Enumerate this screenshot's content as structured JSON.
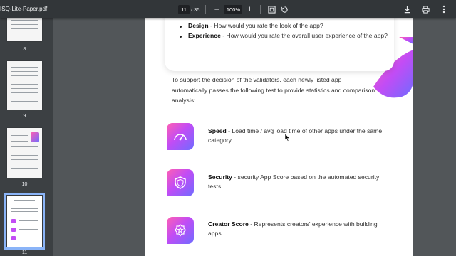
{
  "toolbar": {
    "filename": "ISQ-Lite-Paper.pdf",
    "current_page": "11",
    "separator": "/",
    "total_pages": "35",
    "zoom_out": "–",
    "zoom": "100%",
    "zoom_in": "+"
  },
  "sidebar": {
    "pages": [
      {
        "number": "8"
      },
      {
        "number": "9"
      },
      {
        "number": "10"
      },
      {
        "number": "11"
      }
    ]
  },
  "document": {
    "bullets": [
      {
        "term": "Design",
        "text": " - How would you rate the look of the app?"
      },
      {
        "term": "Experience",
        "text": " - How would you rate the overall user experience of the app?"
      }
    ],
    "intro": "To support the decision of the validators, each newly listed app automatically passes the following test to provide statistics and comparison analysis:",
    "features": [
      {
        "term": "Speed",
        "text": " - Load time / avg load time of other apps under the same category",
        "icon": "speedometer-icon"
      },
      {
        "term": "Security",
        "text": " - security App Score based on the automated security tests",
        "icon": "shield-icon"
      },
      {
        "term": "Creator Score",
        "text": " - Represents creators' experience with building apps",
        "icon": "star-badge-icon"
      }
    ]
  },
  "colors": {
    "gradient_start": "#ff5fb2",
    "gradient_mid": "#c24cf5",
    "gradient_end": "#6f6bff",
    "toolbar_bg": "#323639",
    "sidebar_bg": "#3c4043",
    "viewer_bg": "#525659",
    "selection": "#8ab4f8"
  }
}
